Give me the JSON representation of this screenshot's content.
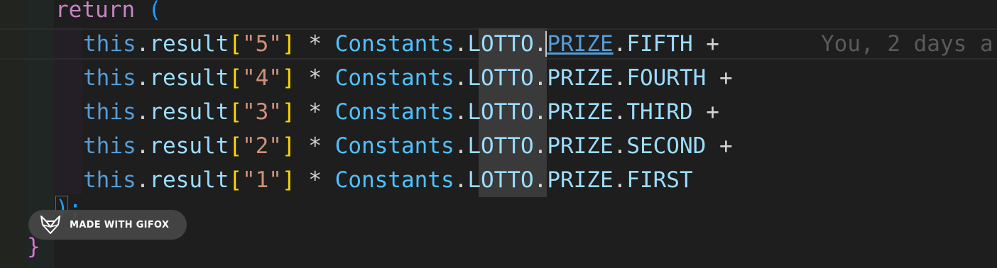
{
  "editor": {
    "line_return": {
      "keyword": "return",
      "paren": "("
    },
    "lines": [
      {
        "this": "this",
        "dot1": ".",
        "prop": "result",
        "lb": "[",
        "str": "\"5\"",
        "rb": "]",
        "op": " * ",
        "cls": "Constants",
        "dot2": ".",
        "lotto": "LOTTO",
        "dot3": ".",
        "prize": "PRIZE",
        "dot4": ".",
        "rank": "FIFTH",
        "plus": " +"
      },
      {
        "this": "this",
        "dot1": ".",
        "prop": "result",
        "lb": "[",
        "str": "\"4\"",
        "rb": "]",
        "op": " * ",
        "cls": "Constants",
        "dot2": ".",
        "lotto": "LOTTO",
        "dot3": ".",
        "prize": "PRIZE",
        "dot4": ".",
        "rank": "FOURTH",
        "plus": " +"
      },
      {
        "this": "this",
        "dot1": ".",
        "prop": "result",
        "lb": "[",
        "str": "\"3\"",
        "rb": "]",
        "op": " * ",
        "cls": "Constants",
        "dot2": ".",
        "lotto": "LOTTO",
        "dot3": ".",
        "prize": "PRIZE",
        "dot4": ".",
        "rank": "THIRD",
        "plus": " +"
      },
      {
        "this": "this",
        "dot1": ".",
        "prop": "result",
        "lb": "[",
        "str": "\"2\"",
        "rb": "]",
        "op": " * ",
        "cls": "Constants",
        "dot2": ".",
        "lotto": "LOTTO",
        "dot3": ".",
        "prize": "PRIZE",
        "dot4": ".",
        "rank": "SECOND",
        "plus": " +"
      },
      {
        "this": "this",
        "dot1": ".",
        "prop": "result",
        "lb": "[",
        "str": "\"1\"",
        "rb": "]",
        "op": " * ",
        "cls": "Constants",
        "dot2": ".",
        "lotto": "LOTTO",
        "dot3": ".",
        "prize": "PRIZE",
        "dot4": ".",
        "rank": "FIRST",
        "plus": ""
      }
    ],
    "close_paren": ");",
    "close_brace": "}",
    "blame_text": "You, 2 days a"
  },
  "watermark": {
    "label": "MADE WITH GIFOX",
    "icon": "fox-head-icon"
  },
  "colors": {
    "background": "#1e1e1e",
    "keyword": "#c586c0",
    "string": "#ce9178",
    "class": "#4fc1ff",
    "bracket": "#ffd700"
  }
}
